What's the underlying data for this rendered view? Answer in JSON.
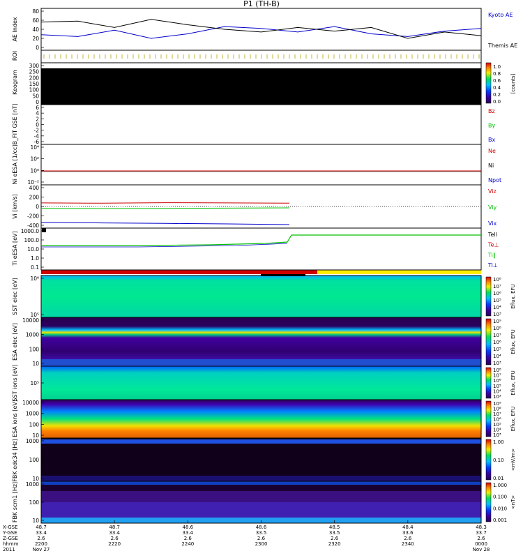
{
  "title": "P1 (TH-B)",
  "colors": {
    "black": "#000000",
    "blue": "#0000cc",
    "red": "#cc0000",
    "green": "#00c000",
    "yellow": "#ffff00"
  },
  "chart_data": [
    {
      "type": "line",
      "id": "ae",
      "ylabel": "AE Index",
      "ylim": [
        0,
        80
      ],
      "yticks": [
        "80",
        "60",
        "40",
        "20",
        "0"
      ],
      "legend": [
        {
          "label": "Kyoto AE",
          "color": "#0000cc"
        },
        {
          "label": "Themis AE",
          "color": "#000000"
        }
      ],
      "x_minutes": [
        0,
        10,
        20,
        30,
        40,
        50,
        60,
        70,
        80,
        90,
        100,
        110,
        120
      ],
      "series": [
        {
          "name": "Kyoto AE",
          "color": "#0000cc",
          "values": [
            28,
            24,
            38,
            20,
            30,
            46,
            42,
            34,
            46,
            30,
            24,
            36,
            42
          ]
        },
        {
          "name": "Themis AE",
          "color": "#000000",
          "values": [
            56,
            58,
            44,
            62,
            50,
            40,
            34,
            44,
            36,
            44,
            20,
            34,
            26
          ]
        }
      ]
    },
    {
      "type": "table",
      "id": "roi",
      "ylabel": "ROI"
    },
    {
      "type": "heatmap",
      "id": "keogram",
      "ylabel": "Keogram",
      "yticks": [
        "300",
        "250",
        "200",
        "150",
        "100",
        "50",
        "0"
      ],
      "colorbar_label": "[counts]",
      "colorbar_ticks": [
        "1.0",
        "0.8",
        "0.6",
        "0.4",
        "0.2",
        "0.0"
      ]
    },
    {
      "type": "line",
      "id": "bfit",
      "ylabel": "B_FIT GSE [nT]",
      "yticks": [
        "6",
        "4",
        "2",
        "0",
        "-2",
        "-4",
        "-6"
      ],
      "legend": [
        {
          "label": "Bz",
          "color": "#cc0000"
        },
        {
          "label": "By",
          "color": "#00c000"
        },
        {
          "label": "Bx",
          "color": "#0000cc"
        }
      ]
    },
    {
      "type": "line",
      "id": "ni",
      "ylabel": "Ni eESA [1/cc]",
      "yticks": [
        "10⁴",
        "10²",
        "10⁰",
        "10⁻²"
      ],
      "legend": [
        {
          "label": "Ne",
          "color": "#cc0000"
        },
        {
          "label": "Ni",
          "color": "#000000"
        },
        {
          "label": "Npot",
          "color": "#0000cc"
        }
      ]
    },
    {
      "type": "line",
      "id": "vi",
      "ylabel": "Vi [km/s]",
      "yticks": [
        "400",
        "200",
        "0",
        "-200",
        "-400"
      ],
      "legend": [
        {
          "label": "Viz",
          "color": "#cc0000"
        },
        {
          "label": "Viy",
          "color": "#00c000"
        },
        {
          "label": "Vix",
          "color": "#0000cc"
        }
      ],
      "series": [
        {
          "name": "Viz",
          "values": [
            75,
            70,
            80,
            75,
            70,
            0
          ]
        },
        {
          "name": "Viy",
          "values": [
            -40,
            -45,
            -40,
            -35,
            -30,
            0
          ]
        },
        {
          "name": "Vix",
          "values": [
            -340,
            -350,
            -360,
            -370,
            -385,
            0
          ]
        }
      ]
    },
    {
      "type": "line",
      "id": "ti",
      "ylabel": "Ti eESA [eV]",
      "yticks": [
        "1000.0",
        "100.0",
        "10.0",
        "1.0",
        "0.1"
      ],
      "legend": [
        {
          "label": "Tell",
          "color": "#000000"
        },
        {
          "label": "Te⊥",
          "color": "#cc0000"
        },
        {
          "label": "Ti∥",
          "color": "#00c000"
        },
        {
          "label": "Ti⊥",
          "color": "#0000cc"
        }
      ]
    },
    {
      "type": "heatmap",
      "id": "sst_e",
      "ylabel": "SST elec [eV]",
      "yticks": [
        "10⁶",
        "10⁵"
      ],
      "colorbar_label": "Eflux, EFU",
      "colorbar_ticks": [
        "10⁸",
        "10⁷",
        "10⁶",
        "10⁵",
        "10⁴",
        "10³"
      ]
    },
    {
      "type": "heatmap",
      "id": "esa_e",
      "ylabel": "ESA elec [eV]",
      "yticks": [
        "10000",
        "1000",
        "100",
        "10"
      ],
      "colorbar_label": "Eflux, EFU",
      "colorbar_ticks": [
        "10⁹",
        "10⁸",
        "10⁷",
        "10⁶",
        "10⁵",
        "10⁴",
        "10³"
      ]
    },
    {
      "type": "heatmap",
      "id": "sst_i",
      "ylabel": "SST ions [eV]",
      "yticks": [
        "10⁵"
      ],
      "colorbar_label": "Eflux, EFU",
      "colorbar_ticks": [
        "10⁸",
        "10⁷",
        "10⁶",
        "10⁵",
        "10⁴",
        "10³"
      ]
    },
    {
      "type": "heatmap",
      "id": "esa_i",
      "ylabel": "ESA ions [eV]",
      "yticks": [
        "10000",
        "1000",
        "100",
        "10"
      ],
      "colorbar_label": "Eflux, EFU",
      "colorbar_ticks": [
        "10⁹",
        "10⁸",
        "10⁷",
        "10⁶",
        "10⁵",
        "10⁴",
        "10³"
      ]
    },
    {
      "type": "heatmap",
      "id": "fbk_e",
      "ylabel": "FBK edc34 [Hz]",
      "yticks": [
        "1000",
        "100",
        "10"
      ],
      "colorbar_label": "<mV/m>",
      "colorbar_ticks": [
        "1.00",
        "0.10",
        "0.01"
      ]
    },
    {
      "type": "heatmap",
      "id": "fbk_b",
      "ylabel": "FBK scm1 [Hz]",
      "yticks": [
        "1000",
        "100",
        "10"
      ],
      "colorbar_label": "<nT>",
      "colorbar_ticks": [
        "1.000",
        "0.100",
        "0.010",
        "0.001"
      ]
    }
  ],
  "xaxis": {
    "row_labels": [
      "X-GSE",
      "Y-GSE",
      "Z-GSE",
      "hhmm",
      "2011"
    ],
    "columns": [
      {
        "x": "48.7",
        "y": "33.4",
        "z": "2.6",
        "time": "2200",
        "date": "Nov 27"
      },
      {
        "x": "48.7",
        "y": "33.4",
        "z": "2.6",
        "time": "2220",
        "date": ""
      },
      {
        "x": "48.6",
        "y": "33.4",
        "z": "2.6",
        "time": "2240",
        "date": ""
      },
      {
        "x": "48.6",
        "y": "33.5",
        "z": "2.6",
        "time": "2300",
        "date": ""
      },
      {
        "x": "48.5",
        "y": "33.5",
        "z": "2.6",
        "time": "2320",
        "date": ""
      },
      {
        "x": "48.4",
        "y": "33.6",
        "z": "2.6",
        "time": "2340",
        "date": ""
      },
      {
        "x": "48.3",
        "y": "33.7",
        "z": "2.6",
        "time": "0000",
        "date": "Nov 28"
      }
    ]
  }
}
